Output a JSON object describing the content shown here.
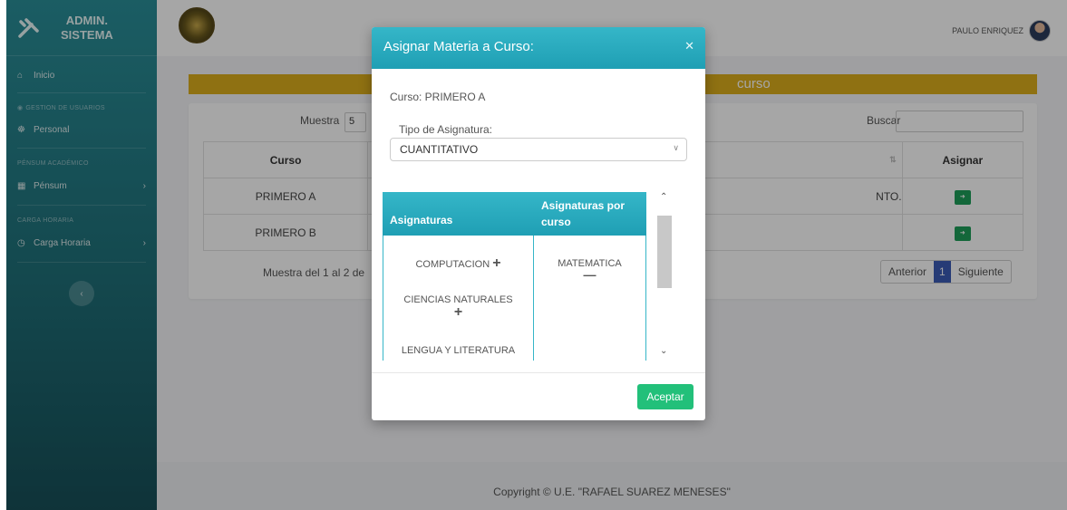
{
  "sidebar": {
    "brand": "ADMIN.\nSISTEMA",
    "items": [
      {
        "label": "Inicio",
        "icon": "home-icon"
      },
      {
        "label": "Personal",
        "icon": "users-icon"
      },
      {
        "label": "Pénsum",
        "icon": "grid-icon"
      },
      {
        "label": "Carga Horaria",
        "icon": "clock-icon"
      }
    ],
    "headers": [
      "GESTION DE USUARIOS",
      "PÉNSUM ACADÉMICO",
      "CARGA HORARIA"
    ]
  },
  "topbar": {
    "user_name": "PAULO ENRIQUEZ"
  },
  "page": {
    "banner_title": "curso"
  },
  "table_controls": {
    "show_label": "Muestra",
    "show_value": "5",
    "search_label": "Buscar"
  },
  "table": {
    "headers": [
      "Curso",
      "",
      "Asignar"
    ],
    "rows": [
      {
        "curso": "PRIMERO A",
        "middle": "NTO."
      },
      {
        "curso": "PRIMERO B",
        "middle": ""
      }
    ],
    "info": "Muestra del 1 al 2 de",
    "pager": {
      "prev": "Anterior",
      "page": "1",
      "next": "Siguiente"
    }
  },
  "footer": {
    "text": "Copyright © U.E. \"RAFAEL SUAREZ MENESES\""
  },
  "modal": {
    "title": "Asignar Materia a Curso:",
    "curso_line": "Curso: PRIMERO A",
    "tipo_label": "Tipo de Asignatura:",
    "tipo_value": "CUANTITATIVO",
    "col1_header": "Asignaturas",
    "col2_header": "Asignaturas por curso",
    "available": [
      "COMPUTACION",
      "CIENCIAS NATURALES",
      "LENGUA Y LITERATURA"
    ],
    "assigned": [
      "MATEMATICA"
    ],
    "accept_label": "Aceptar"
  },
  "colors": {
    "accent": "#1f9fb4",
    "banner": "#dcae1d",
    "success": "#22c07a"
  }
}
